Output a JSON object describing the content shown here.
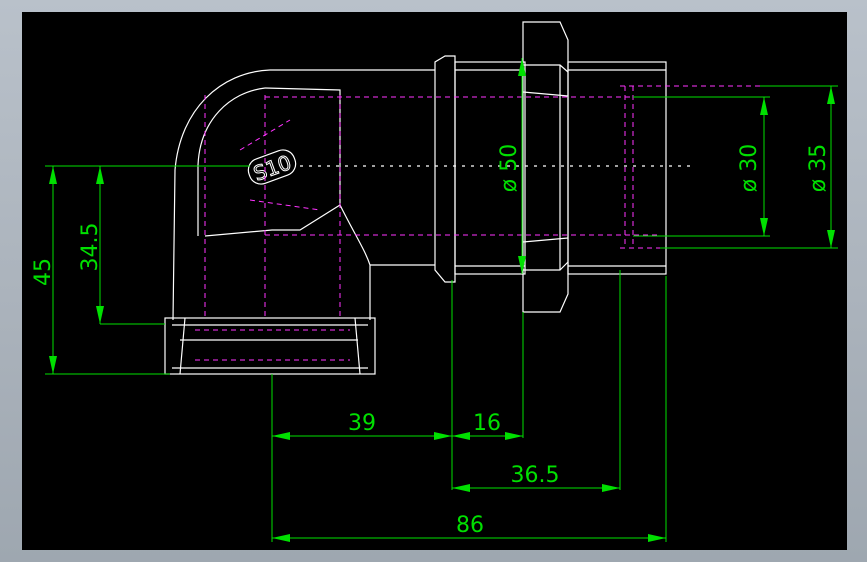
{
  "colors": {
    "outline": "#ffffff",
    "hidden": "#ff33ff",
    "dimension": "#00ff00",
    "background": "#000000",
    "frame": "#aeb6bf"
  },
  "dimensions": {
    "height_45": "45",
    "height_34_5": "34.5",
    "width_39": "39",
    "width_16": "16",
    "width_36_5": "36.5",
    "width_86": "86",
    "diameter_50": "ø 50",
    "diameter_30": "ø 30",
    "diameter_35": "ø 35"
  },
  "logo_text": "S10"
}
